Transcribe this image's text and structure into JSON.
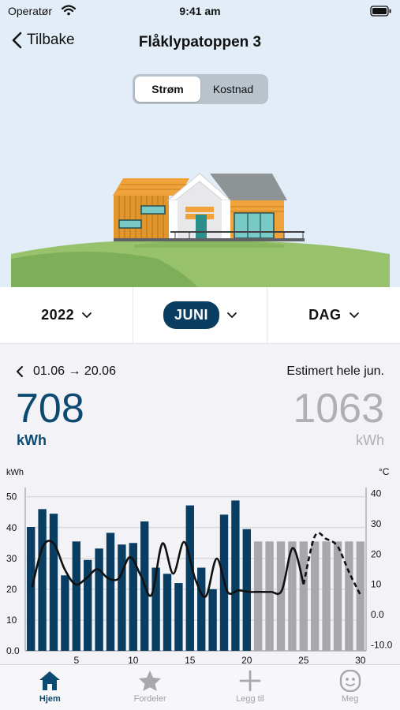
{
  "status_bar": {
    "carrier": "Operatør",
    "time": "9:41 am"
  },
  "nav": {
    "back_label": "Tilbake",
    "title": "Flåklypatoppen 3"
  },
  "segment": {
    "options": [
      "Strøm",
      "Kostnad"
    ],
    "selected": "Strøm"
  },
  "selectors": {
    "year": "2022",
    "month": "JUNI",
    "granularity": "DAG"
  },
  "summary": {
    "range": "01.06 → 20.06",
    "estimate_label": "Estimert hele jun.",
    "actual_value": "708",
    "actual_unit": "kWh",
    "estimate_value": "1063",
    "estimate_unit": "kWh"
  },
  "chart_data": {
    "type": "bar",
    "left_axis_label": "kWh",
    "right_axis_label": "°C",
    "ylim": [
      0,
      53
    ],
    "y2lim": [
      -12,
      42
    ],
    "y_ticks": [
      "0.0",
      "10",
      "20",
      "30",
      "40",
      "50"
    ],
    "y2_ticks": [
      "-10.0",
      "0.0",
      "10",
      "20",
      "30",
      "40"
    ],
    "x_ticks": [
      "5",
      "10",
      "15",
      "20",
      "25",
      "30"
    ],
    "days": [
      1,
      2,
      3,
      4,
      5,
      6,
      7,
      8,
      9,
      10,
      11,
      12,
      13,
      14,
      15,
      16,
      17,
      18,
      19,
      20,
      21,
      22,
      23,
      24,
      25,
      26,
      27,
      28,
      29,
      30
    ],
    "kwh_actual": [
      40.2,
      46,
      44.5,
      24.5,
      35.5,
      29.5,
      33.2,
      38.3,
      34.5,
      35,
      42,
      27,
      25,
      22,
      47.2,
      27,
      20,
      44.2,
      48.8,
      39.5
    ],
    "kwh_estimated": [
      35.5,
      35.5,
      35.5,
      35.5,
      35.5,
      35.5,
      35.5,
      35.5,
      35.5,
      35.5
    ],
    "temperature_measured": [
      9,
      22.5,
      23.5,
      15,
      10,
      12,
      15,
      12,
      12,
      19,
      13,
      6.5,
      23.5,
      13.5,
      24,
      12,
      6,
      18.5,
      7.5,
      8,
      7.5,
      7.5,
      7.5,
      8,
      22,
      10
    ],
    "temperature_forecast": [
      10,
      26,
      25,
      22.5,
      14,
      6.5
    ],
    "colors": {
      "actual": "#0a3d62",
      "estimated": "#a8a8ac",
      "temperature": "#111111",
      "grid": "#d0d0d4"
    }
  },
  "tabs": [
    {
      "label": "Hjem",
      "icon": "home-icon",
      "active": true
    },
    {
      "label": "Fordeler",
      "icon": "star-icon",
      "active": false
    },
    {
      "label": "Legg til",
      "icon": "plus-icon",
      "active": false
    },
    {
      "label": "Meg",
      "icon": "face-icon",
      "active": false
    }
  ]
}
